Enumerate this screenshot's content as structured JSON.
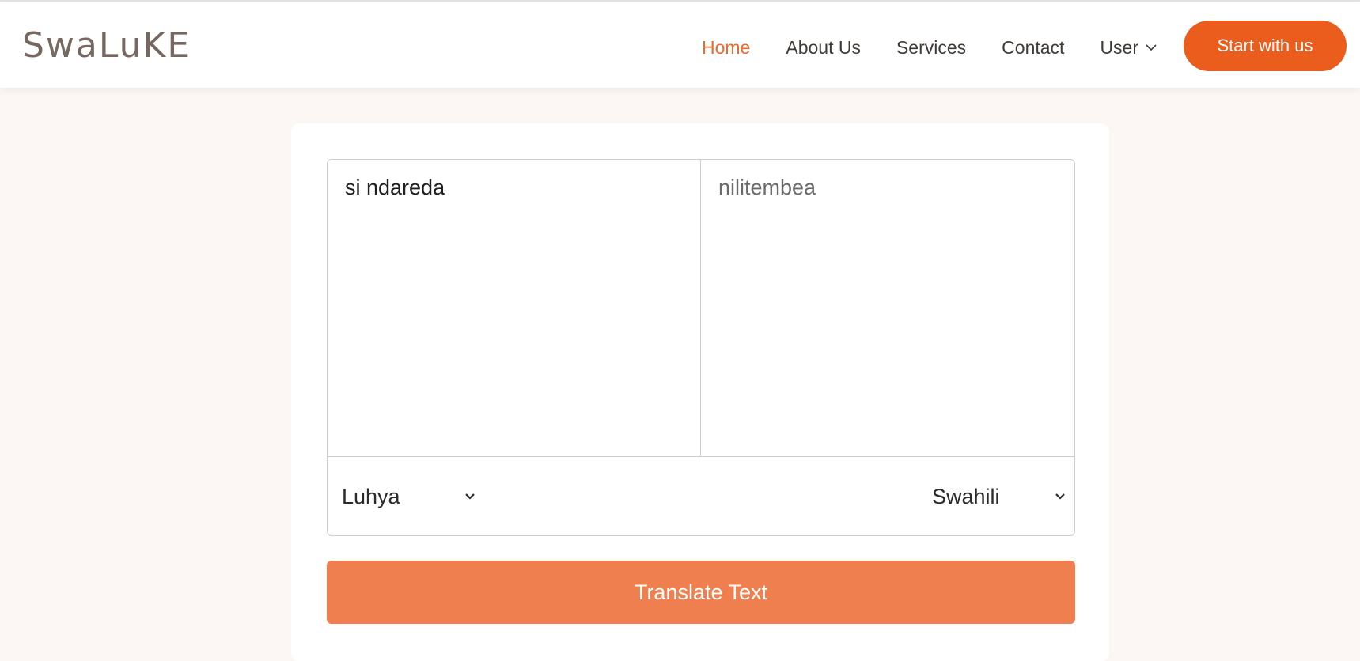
{
  "brand": {
    "logo_text": "SwaLuKE"
  },
  "nav": {
    "items": [
      {
        "label": "Home",
        "active": true
      },
      {
        "label": "About Us",
        "active": false
      },
      {
        "label": "Services",
        "active": false
      },
      {
        "label": "Contact",
        "active": false
      }
    ],
    "user_label": "User",
    "cta_label": "Start with us"
  },
  "translator": {
    "source_text": "si ndareda",
    "target_text": "nilitembea",
    "source_language": "Luhya",
    "target_language": "Swahili",
    "button_label": "Translate Text"
  },
  "colors": {
    "accent": "#ea5d1d",
    "button": "#ef7f4e",
    "background": "#fcf7f4"
  }
}
